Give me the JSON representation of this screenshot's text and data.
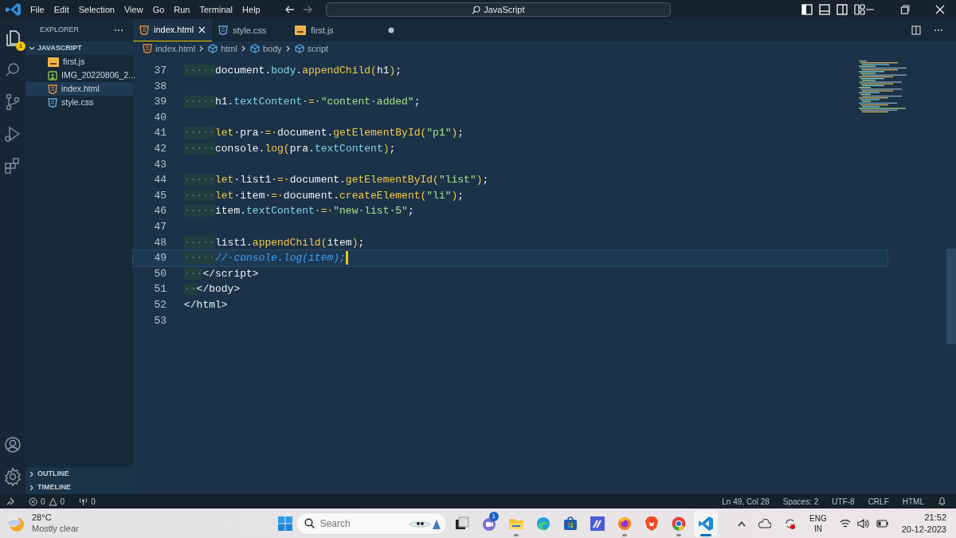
{
  "title_bar": {
    "menu": [
      "File",
      "Edit",
      "Selection",
      "View",
      "Go",
      "Run",
      "Terminal",
      "Help"
    ],
    "command_center": "JavaScript"
  },
  "activity_bar": {
    "items": [
      {
        "kind": "explorer",
        "selected": true,
        "badge": "1"
      },
      {
        "kind": "search",
        "selected": false
      },
      {
        "kind": "source-control",
        "selected": false
      },
      {
        "kind": "run",
        "selected": false
      },
      {
        "kind": "extensions",
        "selected": false
      }
    ],
    "bottom": [
      {
        "kind": "account"
      },
      {
        "kind": "settings"
      }
    ]
  },
  "sidebar": {
    "title": "EXPLORER",
    "folder": {
      "label": "JAVASCRIPT",
      "expanded": true,
      "children": [
        {
          "label": "first.js",
          "kind": "js",
          "selected": false
        },
        {
          "label": "IMG_20220806_2...",
          "kind": "image",
          "selected": false
        },
        {
          "label": "index.html",
          "kind": "html",
          "selected": true
        },
        {
          "label": "style.css",
          "kind": "css",
          "selected": false
        }
      ]
    },
    "panels": [
      {
        "label": "OUTLINE",
        "expanded": false
      },
      {
        "label": "TIMELINE",
        "expanded": false
      }
    ]
  },
  "tabs": [
    {
      "label": "index.html",
      "kind": "html",
      "selected": true,
      "modified": false
    },
    {
      "label": "style.css",
      "kind": "css",
      "selected": false,
      "modified": false
    },
    {
      "label": "first.js",
      "kind": "js",
      "selected": false,
      "modified": true
    }
  ],
  "breadcrumb": [
    {
      "label": "index.html",
      "kind": "html"
    },
    {
      "label": "html",
      "kind": "element"
    },
    {
      "label": "body",
      "kind": "element"
    },
    {
      "label": "script",
      "kind": "element"
    }
  ],
  "lines": [
    {
      "number": "37",
      "current": false,
      "indent": "·····",
      "tokens": [
        {
          "kind": "plain",
          "text": "document."
        },
        {
          "kind": "property",
          "text": "body"
        },
        {
          "kind": "plain",
          "text": "."
        },
        {
          "kind": "function",
          "text": "appendChild("
        },
        {
          "kind": "plain",
          "text": "h1"
        },
        {
          "kind": "function",
          "text": ")"
        },
        {
          "kind": "plain",
          "text": ";"
        }
      ]
    },
    {
      "number": "38",
      "current": false
    },
    {
      "number": "39",
      "current": false,
      "indent": "·····",
      "tokens": [
        {
          "kind": "plain",
          "text": "h1."
        },
        {
          "kind": "property",
          "text": "textContent"
        },
        {
          "kind": "operator",
          "text": "·=·"
        },
        {
          "kind": "string",
          "text": "\"content·added\""
        },
        {
          "kind": "plain",
          "text": ";"
        }
      ]
    },
    {
      "number": "40",
      "current": false
    },
    {
      "number": "41",
      "current": false,
      "indent": "·····",
      "tokens": [
        {
          "kind": "keyword",
          "text": "let"
        },
        {
          "kind": "plain",
          "text": "·pra·"
        },
        {
          "kind": "operator",
          "text": "=·"
        },
        {
          "kind": "plain",
          "text": "document."
        },
        {
          "kind": "function",
          "text": "getElementById("
        },
        {
          "kind": "string",
          "text": "\"p1\""
        },
        {
          "kind": "function",
          "text": ")"
        },
        {
          "kind": "plain",
          "text": ";"
        }
      ]
    },
    {
      "number": "42",
      "current": false,
      "indent": "·····",
      "tokens": [
        {
          "kind": "plain",
          "text": "console."
        },
        {
          "kind": "function",
          "text": "log("
        },
        {
          "kind": "plain",
          "text": "pra."
        },
        {
          "kind": "property",
          "text": "textContent"
        },
        {
          "kind": "function",
          "text": ")"
        },
        {
          "kind": "plain",
          "text": ";"
        }
      ]
    },
    {
      "number": "43",
      "current": false
    },
    {
      "number": "44",
      "current": false,
      "indent": "·····",
      "tokens": [
        {
          "kind": "keyword",
          "text": "let"
        },
        {
          "kind": "plain",
          "text": "·list1·"
        },
        {
          "kind": "operator",
          "text": "=·"
        },
        {
          "kind": "plain",
          "text": "document."
        },
        {
          "kind": "function",
          "text": "getElementById("
        },
        {
          "kind": "string",
          "text": "\"list\""
        },
        {
          "kind": "function",
          "text": ")"
        },
        {
          "kind": "plain",
          "text": ";"
        }
      ]
    },
    {
      "number": "45",
      "current": false,
      "indent": "·····",
      "tokens": [
        {
          "kind": "keyword",
          "text": "let"
        },
        {
          "kind": "plain",
          "text": "·item·"
        },
        {
          "kind": "operator",
          "text": "=·"
        },
        {
          "kind": "plain",
          "text": "document."
        },
        {
          "kind": "function",
          "text": "createElement("
        },
        {
          "kind": "string",
          "text": "\"li\""
        },
        {
          "kind": "function",
          "text": ")"
        },
        {
          "kind": "plain",
          "text": ";"
        }
      ]
    },
    {
      "number": "46",
      "current": false,
      "indent": "·····",
      "tokens": [
        {
          "kind": "plain",
          "text": "item."
        },
        {
          "kind": "property",
          "text": "textContent"
        },
        {
          "kind": "operator",
          "text": "·=·"
        },
        {
          "kind": "string",
          "text": "\"new·list·5\""
        },
        {
          "kind": "plain",
          "text": ";"
        }
      ]
    },
    {
      "number": "47",
      "current": false
    },
    {
      "number": "48",
      "current": false,
      "indent": "·····",
      "tokens": [
        {
          "kind": "plain",
          "text": "list1."
        },
        {
          "kind": "function",
          "text": "appendChild("
        },
        {
          "kind": "plain",
          "text": "item"
        },
        {
          "kind": "function",
          "text": ")"
        },
        {
          "kind": "plain",
          "text": ";"
        }
      ]
    },
    {
      "number": "49",
      "current": true,
      "indent": "·····",
      "tokens": [
        {
          "kind": "comment",
          "text": "//·console.log(item);"
        }
      ]
    },
    {
      "number": "50",
      "current": false,
      "indent": "···",
      "tokens": [
        {
          "kind": "tag",
          "text": "</script>"
        }
      ]
    },
    {
      "number": "51",
      "current": false,
      "indent": "··",
      "tokens": [
        {
          "kind": "tag",
          "text": "</body>"
        }
      ]
    },
    {
      "number": "52",
      "current": false,
      "tokens": [
        {
          "kind": "tag",
          "text": "</html>"
        }
      ]
    },
    {
      "number": "53",
      "current": false
    }
  ],
  "status_bar": {
    "errors": "0",
    "warnings": "0",
    "ports": "0",
    "right": [
      "Ln 49, Col 28",
      "Spaces: 2",
      "UTF-8",
      "CRLF",
      "HTML"
    ]
  },
  "taskbar": {
    "weather": {
      "temperature": "28°C",
      "condition": "Mostly clear"
    },
    "search": {
      "placeholder": "Search"
    },
    "apps": [
      {
        "kind": "task-view",
        "running": false,
        "selected": false
      },
      {
        "kind": "chat",
        "running": false,
        "selected": false,
        "badge": "1"
      },
      {
        "kind": "folder",
        "running": true,
        "selected": false
      },
      {
        "kind": "edge",
        "running": false,
        "selected": false
      },
      {
        "kind": "store",
        "running": false,
        "selected": false
      },
      {
        "kind": "tile",
        "running": false,
        "selected": false
      },
      {
        "kind": "firefox",
        "running": true,
        "selected": false
      },
      {
        "kind": "brave",
        "running": false,
        "selected": false
      },
      {
        "kind": "chrome",
        "running": true,
        "selected": false
      },
      {
        "kind": "vscode",
        "running": true,
        "selected": true
      }
    ],
    "tray": {
      "language": "ENG",
      "region": "IN",
      "time": "21:52",
      "date": "20-12-2023"
    }
  }
}
